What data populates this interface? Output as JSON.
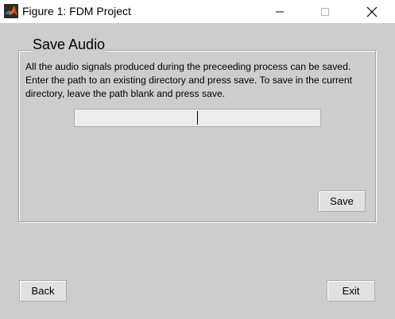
{
  "window": {
    "title": "Figure 1: FDM Project",
    "controls": {
      "minimize": "minimize-icon",
      "maximize": "maximize-icon",
      "close": "close-icon"
    },
    "icon": "matlab-icon"
  },
  "panel": {
    "title": "Save Audio",
    "description": "All the audio signals produced during the preceeding process can be saved. Enter the path to an existing directory and press save. To save in the current directory, leave the path blank and press save.",
    "path_input": {
      "value": "",
      "placeholder": ""
    },
    "save_label": "Save"
  },
  "footer": {
    "back_label": "Back",
    "exit_label": "Exit"
  },
  "colors": {
    "background": "#cdcdcd",
    "titlebar": "#ffffff",
    "button_face": "#e1e1e1",
    "input_face": "#ececec"
  }
}
